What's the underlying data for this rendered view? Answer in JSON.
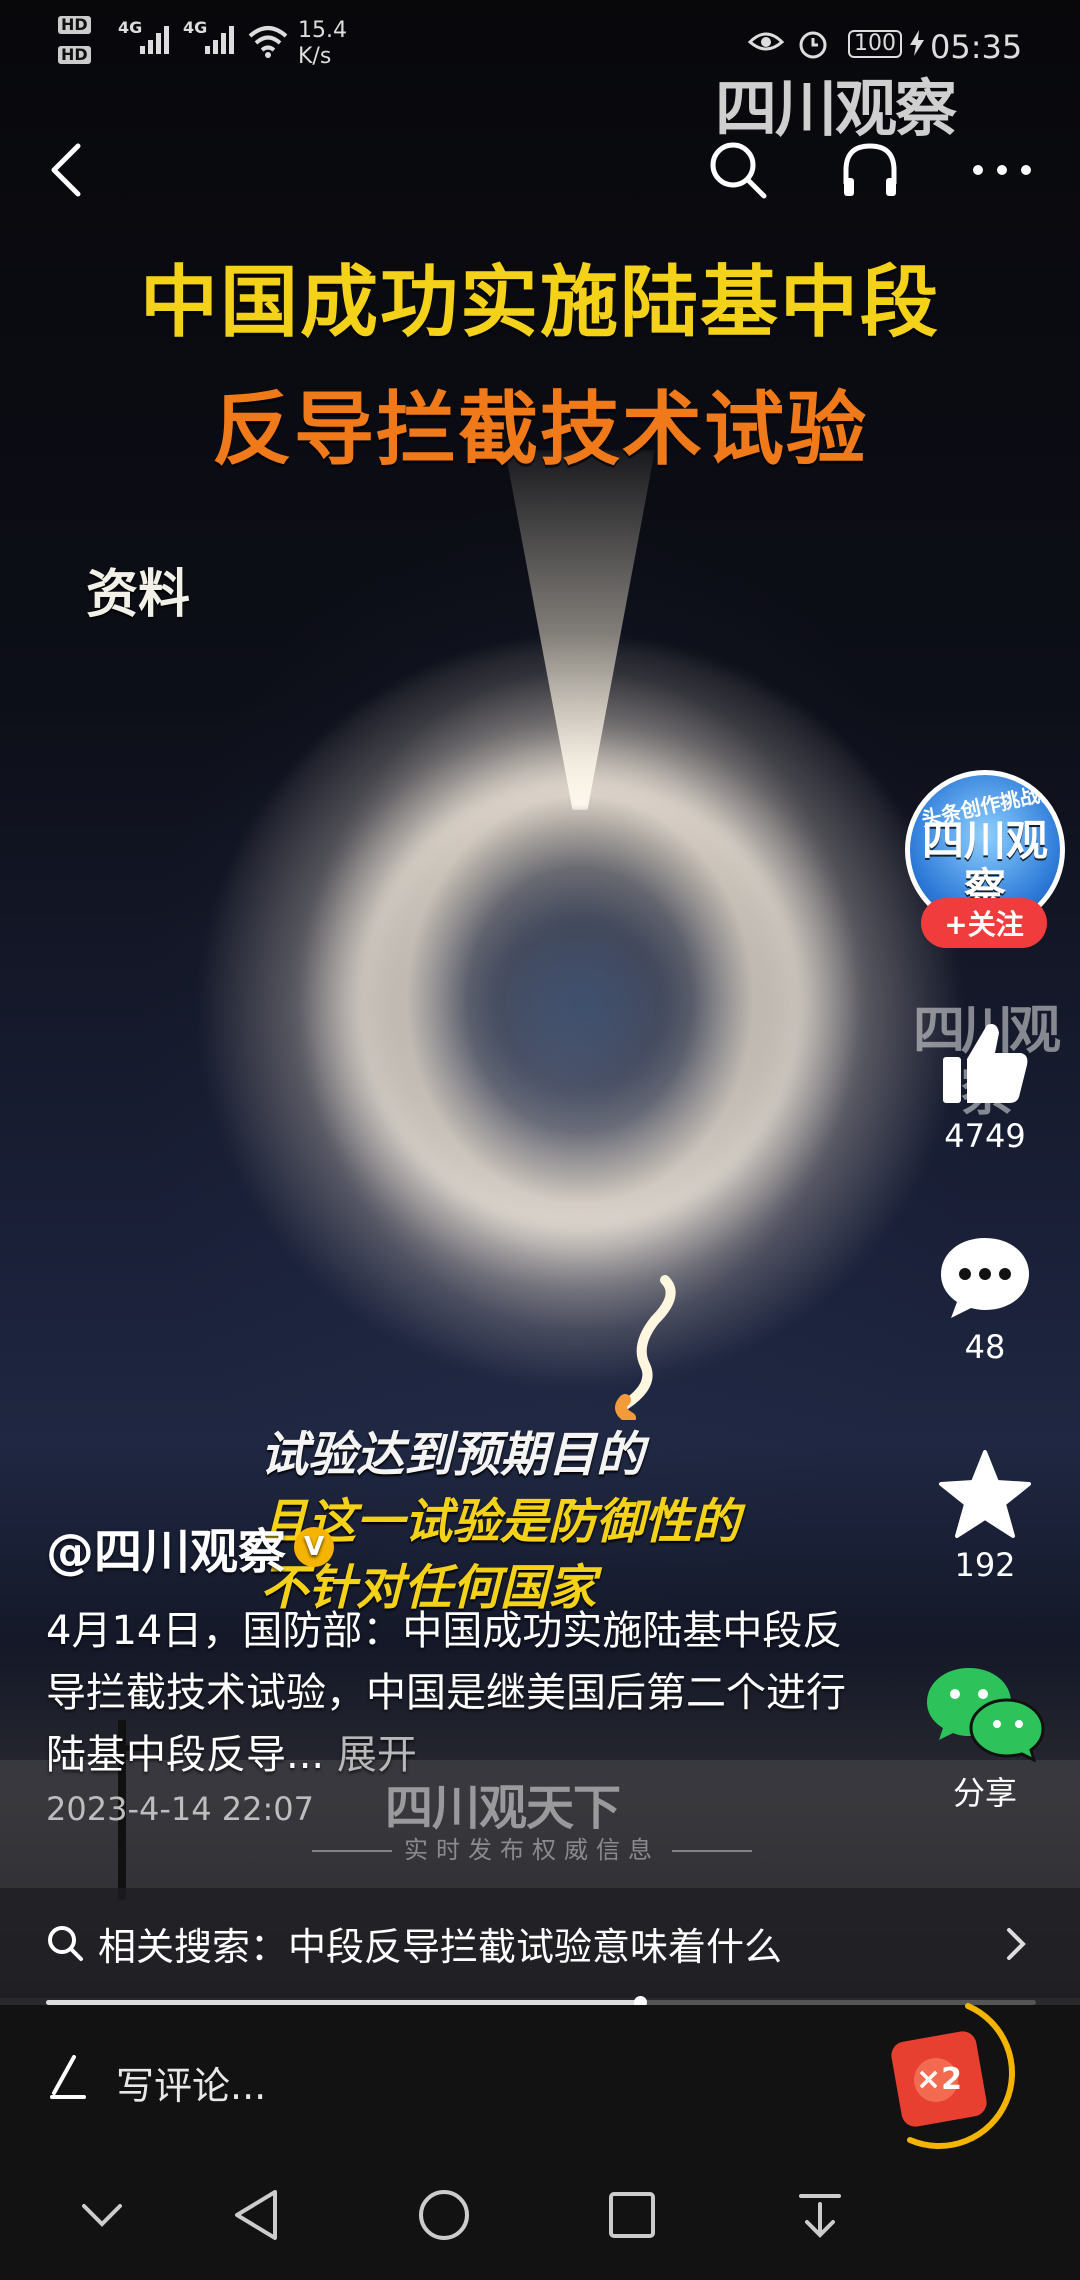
{
  "status_bar": {
    "hd1": "HD",
    "hd2": "HD",
    "net1": "4G",
    "net2": "4G",
    "speed_value": "15.4",
    "speed_unit": "K/s",
    "battery": "100",
    "time": "05:35"
  },
  "video": {
    "headline_line1": "中国成功实施陆基中段",
    "headline_line2": "反导拦截技术试验",
    "tag": "资料",
    "caption_line1": "试验达到预期目的",
    "caption_line2": "且这一试验是防御性的",
    "caption_line3": "不针对任何国家",
    "watermark_top": "四川观察",
    "watermark_side": "四川观察",
    "watermark_bottom": "四川观天下",
    "watermark_bottom_sub": "实时发布权威信息"
  },
  "right_rail": {
    "avatar_band": "头条创作挑战赛",
    "avatar_name": "四川观察",
    "follow_label": "+关注",
    "like_count": "4749",
    "comment_count": "48",
    "favorite_count": "192",
    "share_label": "分享"
  },
  "post": {
    "author": "@四川观察",
    "verified_mark": "V",
    "description": "4月14日，国防部：中国成功实施陆基中段反导拦截技术试验，中国是继美国后第二个进行陆基中段反导...",
    "expand_label": "展开",
    "date": "2023-4-14 22:07"
  },
  "related_search": {
    "text": "相关搜索：中段反导拦截试验意味着什么"
  },
  "playback": {
    "progress": 0.6
  },
  "comment_bar": {
    "placeholder": "写评论..."
  },
  "redpacket": {
    "label": "×2"
  },
  "colors": {
    "headline_yellow": "#f5d21a",
    "headline_orange": "#f07a1a",
    "follow_red": "#f03c3c",
    "wechat_green": "#2dc35a",
    "verified_gold": "#f4b400"
  }
}
